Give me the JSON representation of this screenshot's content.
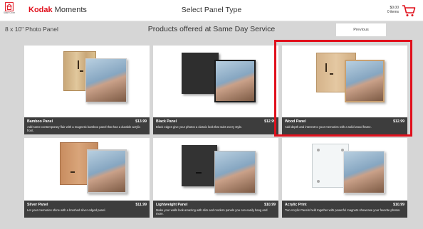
{
  "header": {
    "home_label": "Start Over",
    "brand_bold": "Kodak",
    "brand_rest": " Moments",
    "title": "Select Panel Type",
    "cart_amount": "$0.00",
    "cart_items": "0 items"
  },
  "subheader": {
    "panel_size": "8 x 10\" Photo Panel",
    "subtitle": "Products offered at Same Day Service",
    "previous_label": "Previous"
  },
  "products": [
    {
      "name": "Bamboo Panel",
      "price": "$13.99",
      "description": "Add some contemporary flair with a magnetic bamboo panel that has a durable acrylic front."
    },
    {
      "name": "Black Panel",
      "price": "$12.99",
      "description": "Black edges give your photos a classic look that suits every style."
    },
    {
      "name": "Wood Panel",
      "price": "$12.99",
      "description": "Add depth and interest to your memories with a solid wood frame."
    },
    {
      "name": "Silver Panel",
      "price": "$11.99",
      "description": "Let your memories shine with a brushed silver edged panel."
    },
    {
      "name": "Lightweight Panel",
      "price": "$10.99",
      "description": "Make your walls look amazing with slim and modern panels you can easily hang and more."
    },
    {
      "name": "Acrylic Print",
      "price": "$10.99",
      "description": "Two Acrylic Panels held together with powerful magnets showcase your favorite photos."
    }
  ],
  "colors": {
    "brand_red": "#e0101c",
    "caption_bg": "#3d3d3d",
    "page_bg": "#d6d6d6"
  },
  "icons": [
    "home-icon",
    "cart-icon"
  ]
}
